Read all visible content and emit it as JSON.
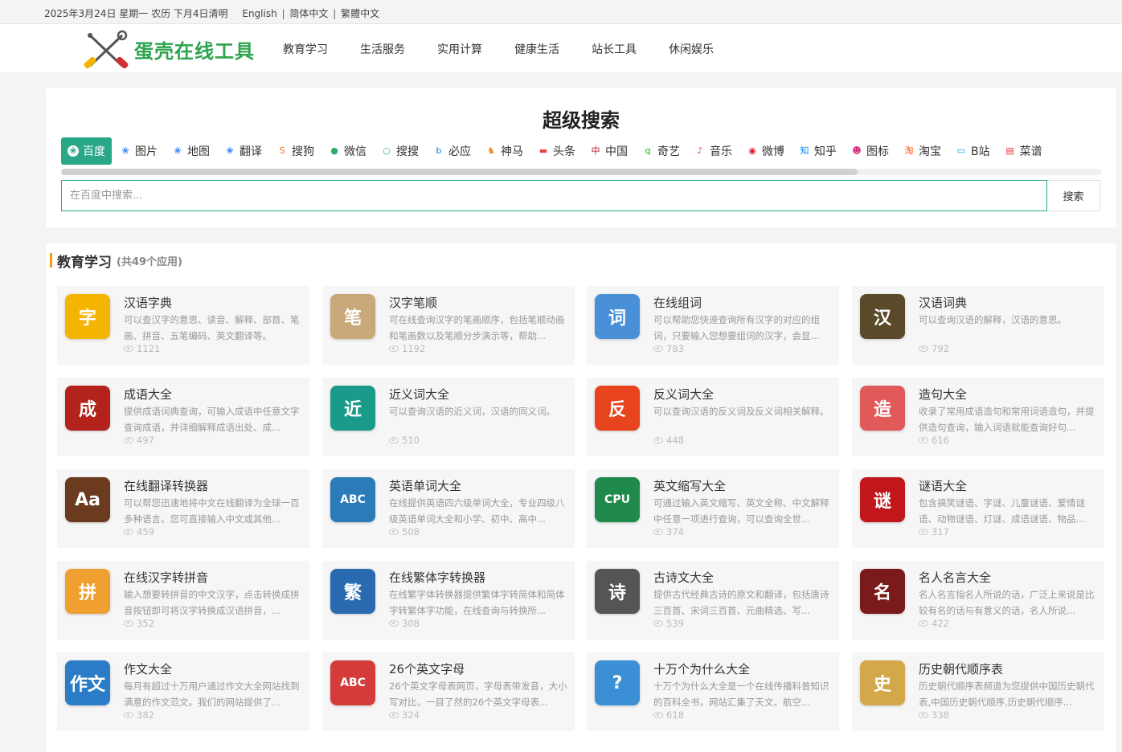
{
  "topbar": {
    "date_text": "2025年3月24日 星期一 农历 下月4日清明",
    "lang_en": "English",
    "lang_sc": "简体中文",
    "lang_tc": "繁體中文",
    "sep": "|"
  },
  "header": {
    "logo_text": "蛋壳在线工具",
    "nav": [
      "教育学习",
      "生活服务",
      "实用计算",
      "健康生活",
      "站长工具",
      "休闲娱乐"
    ]
  },
  "search": {
    "title": "超级搜索",
    "placeholder": "在百度中搜索...",
    "button": "搜索",
    "engines": [
      {
        "label": "百度",
        "icon": "paw-icon",
        "color": "#3385ff",
        "glyph": "❀"
      },
      {
        "label": "图片",
        "icon": "paw-icon",
        "color": "#3385ff",
        "glyph": "❀"
      },
      {
        "label": "地图",
        "icon": "paw-icon",
        "color": "#3385ff",
        "glyph": "❀"
      },
      {
        "label": "翻译",
        "icon": "paw-icon",
        "color": "#3385ff",
        "glyph": "❀"
      },
      {
        "label": "搜狗",
        "icon": "sogou-icon",
        "color": "#f56b2a",
        "glyph": "S"
      },
      {
        "label": "微信",
        "icon": "wechat-icon",
        "color": "#2aae67",
        "glyph": "●"
      },
      {
        "label": "搜搜",
        "icon": "soso-icon",
        "color": "#3bb54a",
        "glyph": "○"
      },
      {
        "label": "必应",
        "icon": "bing-icon",
        "color": "#0a83d6",
        "glyph": "b"
      },
      {
        "label": "神马",
        "icon": "shenma-icon",
        "color": "#f08a24",
        "glyph": "♞"
      },
      {
        "label": "头条",
        "icon": "toutiao-icon",
        "color": "#e8423a",
        "glyph": "▬"
      },
      {
        "label": "中国",
        "icon": "china-icon",
        "color": "#c8102e",
        "glyph": "中"
      },
      {
        "label": "奇艺",
        "icon": "iqiyi-icon",
        "color": "#00be06",
        "glyph": "q"
      },
      {
        "label": "音乐",
        "icon": "music-icon",
        "color": "#e43a2f",
        "glyph": "♪"
      },
      {
        "label": "微博",
        "icon": "weibo-icon",
        "color": "#e6162d",
        "glyph": "◉"
      },
      {
        "label": "知乎",
        "icon": "zhihu-icon",
        "color": "#0084ff",
        "glyph": "知"
      },
      {
        "label": "图标",
        "icon": "alien-icon",
        "color": "#d4237a",
        "glyph": "☻"
      },
      {
        "label": "淘宝",
        "icon": "taobao-icon",
        "color": "#ff5000",
        "glyph": "淘"
      },
      {
        "label": "B站",
        "icon": "bilibili-icon",
        "color": "#00a1d6",
        "glyph": "▭"
      },
      {
        "label": "菜谱",
        "icon": "recipe-icon",
        "color": "#e53935",
        "glyph": "▤"
      }
    ],
    "scroll_fraction": 0.766
  },
  "section": {
    "title": "教育学习",
    "count": "(共49个应用)",
    "cards": [
      {
        "title": "汉语字典",
        "desc": "可以查汉字的意思、读音、解释、部首、笔画、拼音、五笔编码、英文翻译等。",
        "views": "1121",
        "icon": "dictionary-book-icon",
        "color": "#f4b400",
        "glyph": "字"
      },
      {
        "title": "汉字笔顺",
        "desc": "可在线查询汉字的笔画顺序，包括笔顺动画和笔画数以及笔顺分步演示等，帮助...",
        "views": "1192",
        "icon": "brush-stroke-icon",
        "color": "#c9a97a",
        "glyph": "笔"
      },
      {
        "title": "在线组词",
        "desc": "可以帮助您快速查询所有汉字的对应的组词，只要输入您想要组词的汉字，会显...",
        "views": "783",
        "icon": "graduation-books-icon",
        "color": "#4a90d9",
        "glyph": "词"
      },
      {
        "title": "汉语词典",
        "desc": "可以查询汉语的解释，汉语的意思。",
        "views": "792",
        "icon": "cidian-book-icon",
        "color": "#5a4a2a",
        "glyph": "汉"
      },
      {
        "title": "成语大全",
        "desc": "提供成语词典查询，可输入成语中任意文字查询成语，并详细解释成语出处、成...",
        "views": "497",
        "icon": "chengyu-book-icon",
        "color": "#b3221b",
        "glyph": "成"
      },
      {
        "title": "近义词大全",
        "desc": "可以查询汉语的近义词，汉语的同义词。",
        "views": "510",
        "icon": "jin-character-icon",
        "color": "#1a9b8a",
        "glyph": "近"
      },
      {
        "title": "反义词大全",
        "desc": "可以查询汉语的反义词及反义词相关解释。",
        "views": "448",
        "icon": "fan-character-icon",
        "color": "#e8441e",
        "glyph": "反"
      },
      {
        "title": "造句大全",
        "desc": "收录了常用成语造句和常用词语造句，并提供造句查询，输入词语就能查询好句...",
        "views": "616",
        "icon": "zao-ju-icon",
        "color": "#e05a5a",
        "glyph": "造"
      },
      {
        "title": "在线翻译转换器",
        "desc": "可以帮您迅速地将中文在线翻译为全球一百多种语言。您可直接输入中文或其他...",
        "views": "459",
        "icon": "abc-tablet-icon",
        "color": "#6b3a1f",
        "glyph": "Aa"
      },
      {
        "title": "英语单词大全",
        "desc": "在线提供英语四六级单词大全，专业四级八级英语单词大全和小学、初中、高中...",
        "views": "508",
        "icon": "abc-book-icon",
        "color": "#2b7bb9",
        "glyph": "ABC"
      },
      {
        "title": "英文缩写大全",
        "desc": "可通过输入英文缩写、英文全称、中文解释中任意一项进行查询，可以查询全世...",
        "views": "374",
        "icon": "cpu-abbreviation-icon",
        "color": "#1f8a4c",
        "glyph": "CPU"
      },
      {
        "title": "谜语大全",
        "desc": "包含搞笑谜语、字谜、儿童谜语、爱情谜语、动物谜语、灯谜、成语谜语、物品...",
        "views": "317",
        "icon": "lantern-riddle-icon",
        "color": "#c0161c",
        "glyph": "谜"
      },
      {
        "title": "在线汉字转拼音",
        "desc": "输入想要转拼音的中文汉字，点击转换成拼音按钮即可将汉字转换成汉语拼音，...",
        "views": "352",
        "icon": "teddy-book-icon",
        "color": "#f0a030",
        "glyph": "拼"
      },
      {
        "title": "在线繁体字转换器",
        "desc": "在线繁字体转换器提供繁体字转简体和简体字转繁体字功能，在线查询与转换所...",
        "views": "308",
        "icon": "jian-fan-icon",
        "color": "#2a6ab0",
        "glyph": "繁"
      },
      {
        "title": "古诗文大全",
        "desc": "提供古代经典古诗的原文和翻译，包括唐诗三百首、宋词三百首、元曲精选、写...",
        "views": "539",
        "icon": "shi-ci-icon",
        "color": "#555555",
        "glyph": "诗"
      },
      {
        "title": "名人名言大全",
        "desc": "名人名言指名人所说的话，广泛上来说是比较有名的话与有意义的话，名人所说...",
        "views": "422",
        "icon": "famous-quote-icon",
        "color": "#7a1a1a",
        "glyph": "名"
      },
      {
        "title": "作文大全",
        "desc": "每月有超过十万用户通过作文大全网站找到满意的作文范文。我们的网站提供了...",
        "views": "382",
        "icon": "zuowen-icon",
        "color": "#2a7cc7",
        "glyph": "作文"
      },
      {
        "title": "26个英文字母",
        "desc": "26个英文字母表网页，字母表带发音，大小写对比，一目了然的26个英文字母表...",
        "views": "324",
        "icon": "alphabet-icon",
        "color": "#d43c3c",
        "glyph": "ABC"
      },
      {
        "title": "十万个为什么大全",
        "desc": "十万个为什么大全是一个在线传播科普知识的百科全书，网站汇集了天文、航空...",
        "views": "618",
        "icon": "question-marks-icon",
        "color": "#3b8fd4",
        "glyph": "?"
      },
      {
        "title": "历史朝代顺序表",
        "desc": "历史朝代顺序表频道为您提供中国历史朝代表,中国历史朝代顺序,历史朝代顺序...",
        "views": "338",
        "icon": "bamboo-scroll-icon",
        "color": "#d4a84a",
        "glyph": "史"
      }
    ]
  }
}
